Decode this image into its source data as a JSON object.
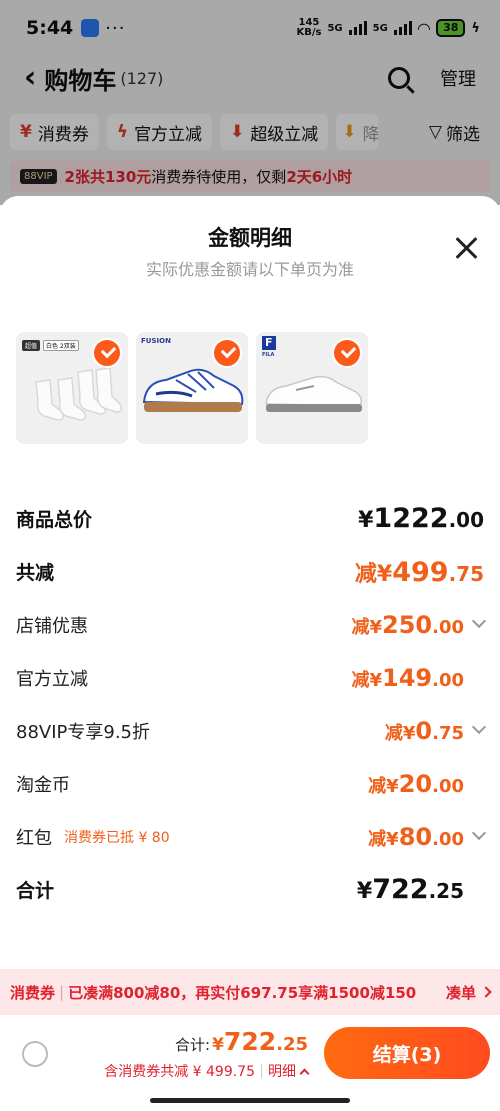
{
  "status_bar": {
    "time": "5:44",
    "dots": "···",
    "net_speed_top": "145",
    "net_speed_bottom": "KB/s",
    "sig1": "5G",
    "sig2": "5G",
    "battery": "38"
  },
  "header": {
    "back_glyph": "‹",
    "title": "购物车",
    "count": "(127)",
    "manage": "管理"
  },
  "chips": [
    {
      "icon": "¥",
      "label": "消费券"
    },
    {
      "icon": "ϟ",
      "label": "官方立减"
    },
    {
      "icon": "⬇",
      "label": "超级立减"
    },
    {
      "icon": "⬇",
      "label": "降"
    }
  ],
  "filter": {
    "icon": "▽",
    "label": "筛选"
  },
  "banner": {
    "tag": "88VIP",
    "highlight": "2张共130元",
    "text": "消费券待使用，仅剩",
    "time_left": "2天6小时"
  },
  "sheet": {
    "title": "金额明细",
    "subtitle": "实际优惠金额请以下单页为准",
    "thumbnails": [
      {
        "name": "socks",
        "tags": [
          "超值",
          "白色 2双装"
        ],
        "brand": ""
      },
      {
        "name": "sneaker-blue",
        "tags": [],
        "brand": "FUSION"
      },
      {
        "name": "sneaker-white",
        "tags": [],
        "brand": "FILA"
      }
    ],
    "rows": [
      {
        "label": "商品总价",
        "prefix": "¥",
        "int": "1222",
        "dec": ".00"
      },
      {
        "label": "共减",
        "prefix": "减¥",
        "int": "499",
        "dec": ".75"
      },
      {
        "label": "店铺优惠",
        "prefix": "减¥",
        "int": "250",
        "dec": ".00"
      },
      {
        "label": "官方立减",
        "prefix": "减¥",
        "int": "149",
        "dec": ".00"
      },
      {
        "label": "88VIP专享9.5折",
        "prefix": "减¥",
        "int": "0",
        "dec": ".75"
      },
      {
        "label": "淘金币",
        "prefix": "减¥",
        "int": "20",
        "dec": ".00"
      },
      {
        "label": "红包",
        "note": "消费券已抵 ¥ 80",
        "prefix": "减¥",
        "int": "80",
        "dec": ".00"
      },
      {
        "label": "合计",
        "prefix": "¥",
        "int": "722",
        "dec": ".25"
      }
    ]
  },
  "promo": {
    "tag": "消费券",
    "text": "已凑满800减80，再实付697.75享满1500减150",
    "action": "凑单"
  },
  "footer": {
    "total_label": "合计:",
    "total_prefix": "¥",
    "total_int": "722",
    "total_dec": ".25",
    "saving_text": "含消费券共减 ¥ 499.75",
    "detail": "明细",
    "checkout": "结算(3)"
  },
  "colors": {
    "accent": "#FF5A1A",
    "red": "#E0222F"
  }
}
